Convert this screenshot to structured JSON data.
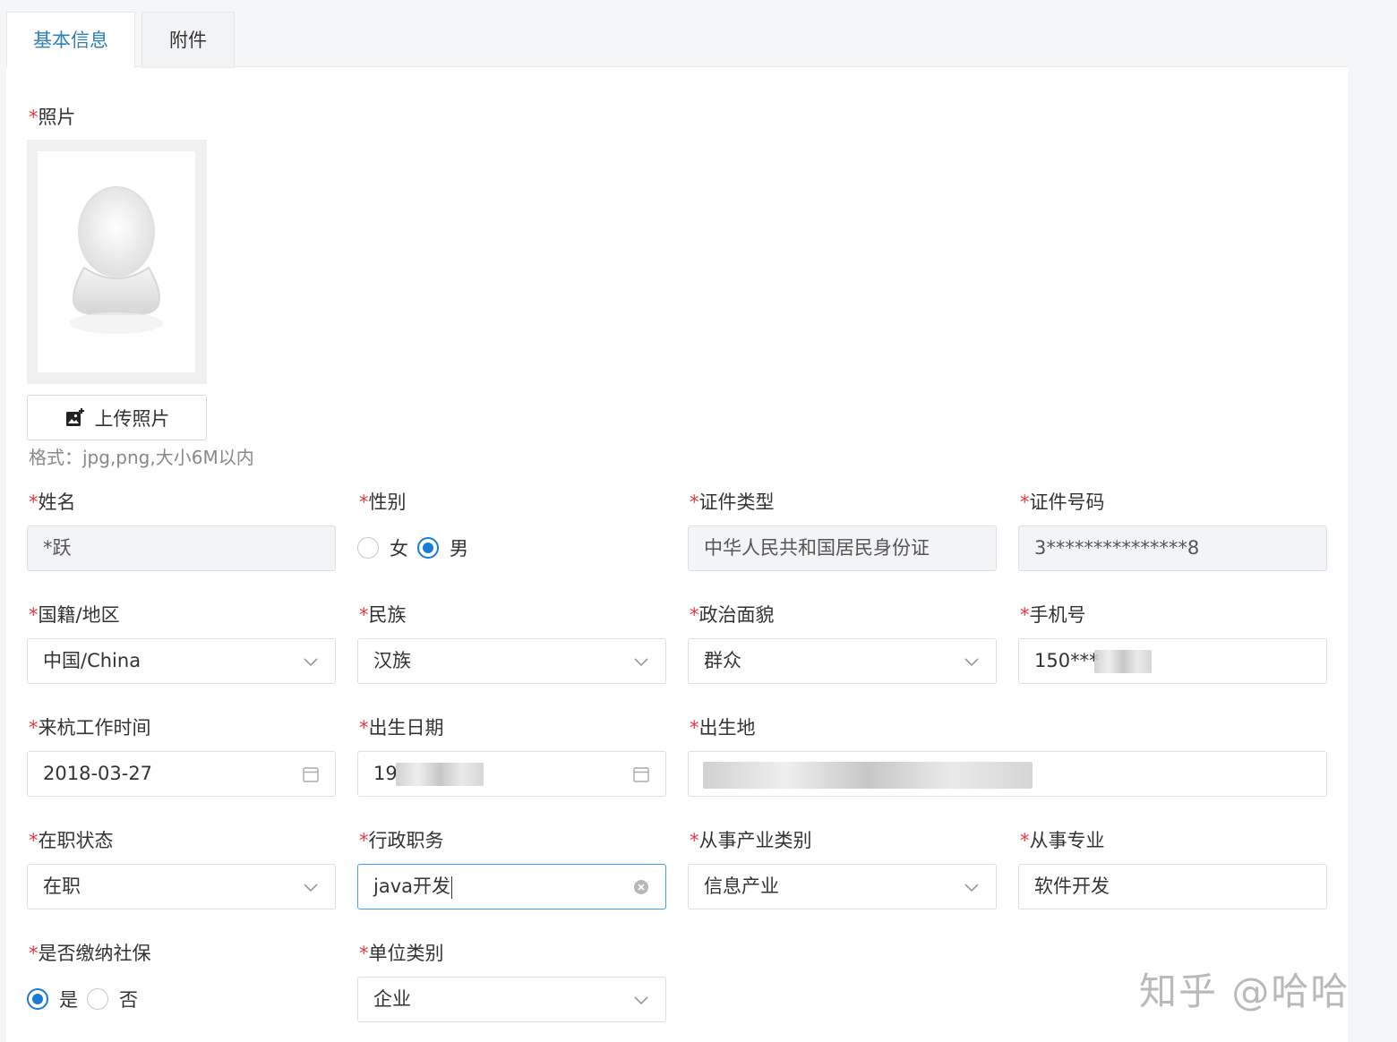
{
  "tabs": [
    {
      "label": "基本信息",
      "active": true
    },
    {
      "label": "附件",
      "active": false
    }
  ],
  "photo": {
    "label": "照片",
    "upload_label": "上传照片",
    "hint": "格式：jpg,png,大小6M以内"
  },
  "fields": {
    "name": {
      "label": "姓名",
      "value": "*跃"
    },
    "gender": {
      "label": "性别",
      "options": [
        "女",
        "男"
      ],
      "selected": "男"
    },
    "id_type": {
      "label": "证件类型",
      "value": "中华人民共和国居民身份证"
    },
    "id_number": {
      "label": "证件号码",
      "value": "3***************8"
    },
    "nationality": {
      "label": "国籍/地区",
      "value": "中国/China"
    },
    "ethnicity": {
      "label": "民族",
      "value": "汉族"
    },
    "political": {
      "label": "政治面貌",
      "value": "群众"
    },
    "phone": {
      "label": "手机号",
      "value": "150***"
    },
    "work_start": {
      "label": "来杭工作时间",
      "value": "2018-03-27"
    },
    "birth_date": {
      "label": "出生日期",
      "value": "19"
    },
    "birthplace": {
      "label": "出生地",
      "value": ""
    },
    "employment": {
      "label": "在职状态",
      "value": "在职"
    },
    "position": {
      "label": "行政职务",
      "value": "java开发"
    },
    "industry": {
      "label": "从事产业类别",
      "value": "信息产业"
    },
    "major": {
      "label": "从事专业",
      "value": "软件开发"
    },
    "social_security": {
      "label": "是否缴纳社保",
      "options": [
        "是",
        "否"
      ],
      "selected": "是"
    },
    "unit_type": {
      "label": "单位类别",
      "value": "企业"
    }
  },
  "required_mark": "*",
  "watermark": "知乎 @哈哈",
  "colors": {
    "accent": "#1a7bd5",
    "tab_active": "#2d7fc0",
    "required": "#e4393c"
  }
}
